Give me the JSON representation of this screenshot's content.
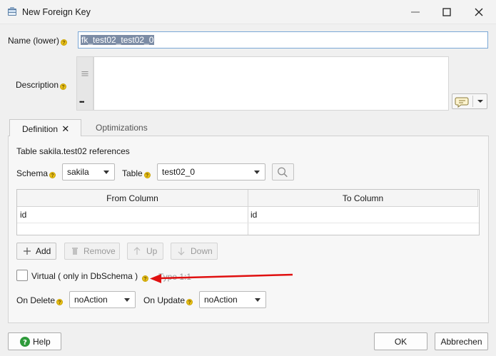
{
  "window": {
    "title": "New Foreign Key",
    "icon": "database-table-icon"
  },
  "form": {
    "name_label": "Name (lower)",
    "name_value": "fk_test02_test02_0",
    "description_label": "Description",
    "description_value": "",
    "description_gutter_more": "•••"
  },
  "tabs": [
    {
      "label": "Definition",
      "active": true,
      "closable": true
    },
    {
      "label": "Optimizations",
      "active": false
    }
  ],
  "definition": {
    "table_reference_text": "Table sakila.test02 references",
    "schema_label": "Schema",
    "schema_value": "sakila",
    "table_label": "Table",
    "table_value": "test02_0",
    "grid": {
      "columns": [
        "From Column",
        "To Column"
      ],
      "rows": [
        [
          "id",
          "id"
        ]
      ]
    },
    "buttons": {
      "add": "Add",
      "remove": "Remove",
      "up": "Up",
      "down": "Down"
    },
    "virtual_label": "Virtual ( only in DbSchema )",
    "virtual_checked": false,
    "type_text": "Type 1:1",
    "on_delete_label": "On Delete",
    "on_delete_value": "noAction",
    "on_update_label": "On Update",
    "on_update_value": "noAction"
  },
  "footer": {
    "help": "Help",
    "ok": "OK",
    "cancel": "Abbrechen"
  },
  "colors": {
    "annotation_arrow": "#e01010",
    "help_badge": "#e8c11a",
    "selection": "#7c8ca5"
  }
}
